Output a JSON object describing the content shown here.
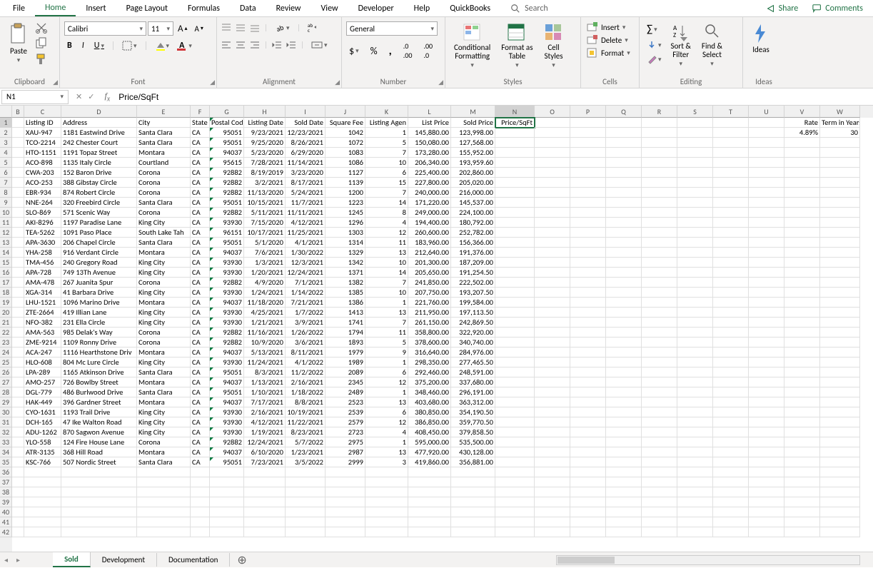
{
  "menu": {
    "items": [
      "File",
      "Home",
      "Insert",
      "Page Layout",
      "Formulas",
      "Data",
      "Review",
      "View",
      "Developer",
      "Help",
      "QuickBooks"
    ],
    "search": "Search",
    "share": "Share",
    "comments": "Comments"
  },
  "ribbon": {
    "clipboard": {
      "title": "Clipboard",
      "paste": "Paste"
    },
    "font": {
      "title": "Font",
      "name": "Calibri",
      "size": "11"
    },
    "alignment": {
      "title": "Alignment"
    },
    "number": {
      "title": "Number",
      "format": "General"
    },
    "styles": {
      "title": "Styles",
      "cond": "Conditional\nFormatting",
      "table": "Format as\nTable",
      "cell": "Cell\nStyles"
    },
    "cells": {
      "title": "Cells",
      "insert": "Insert",
      "delete": "Delete",
      "format": "Format"
    },
    "editing": {
      "title": "Editing",
      "sort": "Sort &\nFilter",
      "find": "Find &\nSelect"
    },
    "ideas": {
      "title": "Ideas",
      "ideas": "Ideas"
    }
  },
  "formula_bar": {
    "name_box": "N1",
    "formula": "Price/SqFt"
  },
  "columns": [
    {
      "l": "B",
      "w": 17
    },
    {
      "l": "C",
      "w": 52
    },
    {
      "l": "D",
      "w": 106
    },
    {
      "l": "E",
      "w": 75
    },
    {
      "l": "F",
      "w": 27
    },
    {
      "l": "G",
      "w": 48
    },
    {
      "l": "H",
      "w": 58
    },
    {
      "l": "I",
      "w": 56
    },
    {
      "l": "J",
      "w": 56
    },
    {
      "l": "K",
      "w": 60
    },
    {
      "l": "L",
      "w": 60
    },
    {
      "l": "M",
      "w": 62
    },
    {
      "l": "N",
      "w": 55
    },
    {
      "l": "O",
      "w": 50
    },
    {
      "l": "P",
      "w": 50
    },
    {
      "l": "Q",
      "w": 50
    },
    {
      "l": "R",
      "w": 50
    },
    {
      "l": "S",
      "w": 50
    },
    {
      "l": "T",
      "w": 50
    },
    {
      "l": "U",
      "w": 50
    },
    {
      "l": "V",
      "w": 50
    },
    {
      "l": "W",
      "w": 56
    }
  ],
  "header_row": [
    "",
    "Listing ID",
    "Address",
    "City",
    "State",
    "Postal Cod",
    "Listing Date",
    "Sold Date",
    "Square Fee",
    "Listing Agen",
    "List Price",
    "Sold Price",
    "Price/SqFt",
    "",
    "",
    "",
    "",
    "",
    "",
    "",
    "Rate",
    "Term in Years"
  ],
  "v2": "4.89%",
  "w2": "30",
  "rows": [
    [
      "XAU-947",
      "1181 Eastwind Drive",
      "Santa Clara",
      "CA",
      "95051",
      "9/23/2021",
      "12/23/2021",
      "1042",
      "1",
      "145,880.00",
      "123,998.00"
    ],
    [
      "TCO-2214",
      "242 Chester Court",
      "Santa Clara",
      "CA",
      "95051",
      "9/25/2020",
      "8/26/2021",
      "1072",
      "5",
      "150,080.00",
      "127,568.00"
    ],
    [
      "HTO-1151",
      "1191 Topaz Street",
      "Montara",
      "CA",
      "94037",
      "5/23/2020",
      "6/29/2020",
      "1083",
      "7",
      "173,280.00",
      "155,952.00"
    ],
    [
      "ACO-898",
      "1135 Italy Circle",
      "Courtland",
      "CA",
      "95615",
      "7/28/2021",
      "11/14/2021",
      "1086",
      "10",
      "206,340.00",
      "193,959.60"
    ],
    [
      "CWA-203",
      "152 Baron Drive",
      "Corona",
      "CA",
      "92882",
      "8/19/2019",
      "3/23/2020",
      "1127",
      "6",
      "225,400.00",
      "202,860.00"
    ],
    [
      "ACO-253",
      "388 Gibstay Circle",
      "Corona",
      "CA",
      "92882",
      "3/2/2021",
      "8/17/2021",
      "1139",
      "15",
      "227,800.00",
      "205,020.00"
    ],
    [
      "EBR-934",
      "874 Robert Circle",
      "Corona",
      "CA",
      "92882",
      "11/13/2020",
      "5/24/2021",
      "1200",
      "7",
      "240,000.00",
      "216,000.00"
    ],
    [
      "NNE-264",
      "320 Freebird Circle",
      "Santa Clara",
      "CA",
      "95051",
      "10/15/2021",
      "11/7/2021",
      "1223",
      "14",
      "171,220.00",
      "145,537.00"
    ],
    [
      "SLO-869",
      "571 Scenic Way",
      "Corona",
      "CA",
      "92882",
      "5/11/2021",
      "11/11/2021",
      "1245",
      "8",
      "249,000.00",
      "224,100.00"
    ],
    [
      "AKI-8296",
      "1197 Paradise Lane",
      "King City",
      "CA",
      "93930",
      "7/15/2020",
      "4/12/2021",
      "1296",
      "4",
      "194,400.00",
      "180,792.00"
    ],
    [
      "TEA-5262",
      "1091 Paso Place",
      "South Lake Tah",
      "CA",
      "96151",
      "10/17/2021",
      "11/25/2021",
      "1303",
      "12",
      "260,600.00",
      "252,782.00"
    ],
    [
      "APA-3630",
      "206 Chapel Circle",
      "Santa Clara",
      "CA",
      "95051",
      "5/1/2020",
      "4/1/2021",
      "1314",
      "11",
      "183,960.00",
      "156,366.00"
    ],
    [
      "YHA-258",
      "916 Verdant Circle",
      "Montara",
      "CA",
      "94037",
      "7/6/2021",
      "1/30/2022",
      "1329",
      "13",
      "212,640.00",
      "191,376.00"
    ],
    [
      "TMA-456",
      "240 Gregory Road",
      "King City",
      "CA",
      "93930",
      "1/3/2021",
      "12/3/2021",
      "1342",
      "10",
      "201,300.00",
      "187,209.00"
    ],
    [
      "APA-728",
      "749 13Th Avenue",
      "King City",
      "CA",
      "93930",
      "1/20/2021",
      "12/24/2021",
      "1371",
      "14",
      "205,650.00",
      "191,254.50"
    ],
    [
      "AMA-478",
      "267 Juanita Spur",
      "Corona",
      "CA",
      "92882",
      "4/9/2020",
      "7/1/2021",
      "1382",
      "7",
      "241,850.00",
      "222,502.00"
    ],
    [
      "XGA-314",
      "41 Barbara Drive",
      "King City",
      "CA",
      "93930",
      "1/24/2021",
      "1/14/2022",
      "1385",
      "10",
      "207,750.00",
      "193,207.50"
    ],
    [
      "LHU-1521",
      "1096 Marino Drive",
      "Montara",
      "CA",
      "94037",
      "11/18/2020",
      "7/21/2021",
      "1386",
      "1",
      "221,760.00",
      "199,584.00"
    ],
    [
      "ZTE-2664",
      "419 Illian Lane",
      "King City",
      "CA",
      "93930",
      "4/25/2021",
      "1/7/2022",
      "1413",
      "13",
      "211,950.00",
      "197,113.50"
    ],
    [
      "NFO-382",
      "231 Ella Circle",
      "King City",
      "CA",
      "93930",
      "1/21/2021",
      "3/9/2021",
      "1741",
      "7",
      "261,150.00",
      "242,869.50"
    ],
    [
      "AMA-563",
      "985 Delak's Way",
      "Corona",
      "CA",
      "92882",
      "11/16/2021",
      "1/26/2022",
      "1794",
      "11",
      "358,800.00",
      "322,920.00"
    ],
    [
      "ZME-9214",
      "1109 Ronny Drive",
      "Corona",
      "CA",
      "92882",
      "10/9/2020",
      "3/6/2021",
      "1893",
      "5",
      "378,600.00",
      "340,740.00"
    ],
    [
      "ACA-247",
      "1116 Hearthstone Driv",
      "Montara",
      "CA",
      "94037",
      "5/13/2021",
      "8/11/2021",
      "1979",
      "9",
      "316,640.00",
      "284,976.00"
    ],
    [
      "HLO-608",
      "804 Mc Lure Circle",
      "King City",
      "CA",
      "93930",
      "11/24/2021",
      "4/1/2022",
      "1989",
      "1",
      "298,350.00",
      "277,465.50"
    ],
    [
      "LPA-289",
      "1165 Atkinson Drive",
      "Santa Clara",
      "CA",
      "95051",
      "8/3/2021",
      "11/2/2022",
      "2089",
      "6",
      "292,460.00",
      "248,591.00"
    ],
    [
      "AMO-257",
      "726 Bowlby Street",
      "Montara",
      "CA",
      "94037",
      "1/13/2021",
      "2/16/2021",
      "2345",
      "12",
      "375,200.00",
      "337,680.00"
    ],
    [
      "DGL-779",
      "486 Burlwood Drive",
      "Santa Clara",
      "CA",
      "95051",
      "1/10/2021",
      "1/18/2022",
      "2489",
      "1",
      "348,460.00",
      "296,191.00"
    ],
    [
      "HAK-449",
      "396 Gardner Street",
      "Montara",
      "CA",
      "94037",
      "7/17/2021",
      "8/8/2021",
      "2523",
      "13",
      "403,680.00",
      "363,312.00"
    ],
    [
      "CYO-1631",
      "1193 Trail Drive",
      "King City",
      "CA",
      "93930",
      "2/16/2021",
      "10/19/2021",
      "2539",
      "6",
      "380,850.00",
      "354,190.50"
    ],
    [
      "DCH-165",
      "47 Ike Walton Road",
      "King City",
      "CA",
      "93930",
      "4/12/2021",
      "11/22/2021",
      "2579",
      "12",
      "386,850.00",
      "359,770.50"
    ],
    [
      "ADU-1262",
      "870 Sagwon Avenue",
      "King City",
      "CA",
      "93930",
      "1/19/2021",
      "8/23/2021",
      "2723",
      "4",
      "408,450.00",
      "379,858.50"
    ],
    [
      "YLO-558",
      "124 Fire House Lane",
      "Corona",
      "CA",
      "92882",
      "12/24/2021",
      "5/7/2022",
      "2975",
      "1",
      "595,000.00",
      "535,500.00"
    ],
    [
      "ATR-3135",
      "368 Hill Road",
      "Montara",
      "CA",
      "94037",
      "6/10/2020",
      "1/23/2021",
      "2987",
      "13",
      "477,920.00",
      "430,128.00"
    ],
    [
      "KSC-766",
      "507 Nordic Street",
      "Santa Clara",
      "CA",
      "95051",
      "7/23/2021",
      "3/5/2022",
      "2999",
      "3",
      "419,860.00",
      "356,881.00"
    ]
  ],
  "sheets": {
    "tabs": [
      "Sold",
      "Development",
      "Documentation"
    ],
    "active": 0
  }
}
